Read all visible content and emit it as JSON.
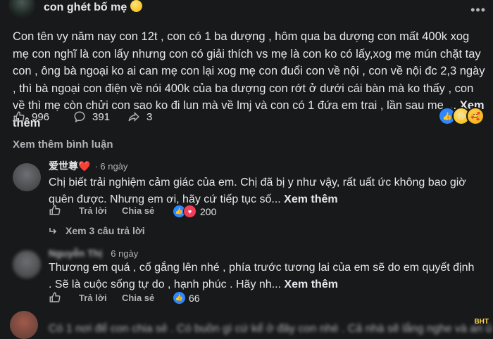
{
  "post": {
    "author": "con ghét bố mẹ",
    "text": "Con tên vy năm nay con 12t , con có 1 ba dượng , hôm qua ba dượng con mất 400k xog mẹ con nghĩ là con lấy nhưng con có giải thích vs mẹ là con ko có lấy,xog mẹ mún chặt tay con , ông bà ngoại ko ai can mẹ con lại xog mẹ con đuổi con về nội , con về nội đc 2,3 ngày , thì bà ngoại con điện về nói 400k của ba dượng con rớt ở dưới cái bàn mà ko thấy , con về thì mẹ còn chửi con sao ko đi lun mà về lmj và con có 1 đứa em trai , lần sau mẹ ...",
    "see_more": "Xem thêm",
    "likes": "996",
    "comments": "391",
    "shares": "3"
  },
  "view_more_comments": "Xem thêm bình luận",
  "comments": [
    {
      "name": "爱世尊❤️",
      "time": "· 6 ngày",
      "text": "Chị biết trải nghiệm cảm giác của em. Chị đã bị y như vậy, rất uất ức không bao giờ quên được. Nhưng em ơi, hãy cứ tiếp tục số...",
      "see_more": "Xem thêm",
      "reply": "Trả lời",
      "share": "Chia sẻ",
      "reactions": "200",
      "replies": "Xem 3 câu trả lời"
    },
    {
      "name": "Nguyễn Thị",
      "time": "6 ngày",
      "text": "Thương em quá , cố gắng lên nhé , phía trước tương lai của em sẽ do em quyết định . Sẽ là cuộc sống tự do , hạnh phúc . Hãy nh...",
      "see_more": "Xem thêm",
      "reply": "Trả lời",
      "share": "Chia sẻ",
      "reactions": "66"
    },
    {
      "text": "Có 1 nơi để con chia sẻ . Có buồn gì cứ kể ở đây con nhé . Cả nhà sẽ lắng nghe và an ủi"
    }
  ],
  "watermark": "BHT"
}
